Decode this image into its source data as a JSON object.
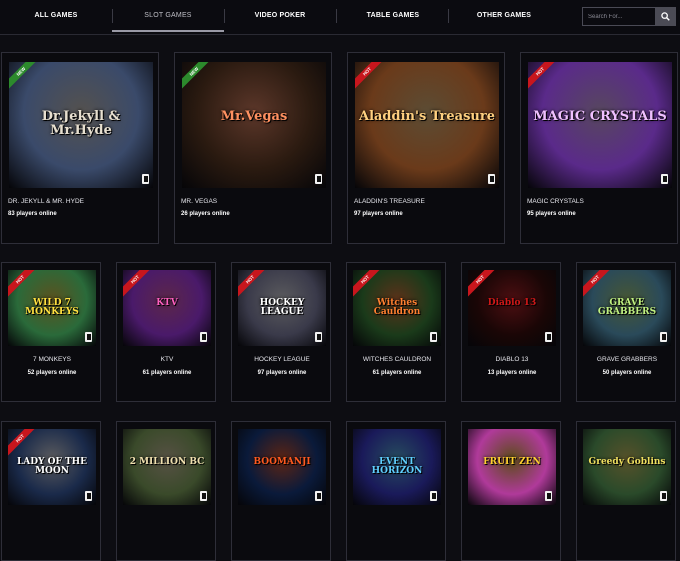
{
  "nav": {
    "tabs": [
      {
        "label": "ALL GAMES",
        "active": false
      },
      {
        "label": "SLOT GAMES",
        "active": true
      },
      {
        "label": "VIDEO POKER",
        "active": false
      },
      {
        "label": "TABLE GAMES",
        "active": false
      },
      {
        "label": "OTHER GAMES",
        "active": false
      }
    ],
    "search_placeholder": "Search For...",
    "search_icon": "search-icon"
  },
  "games": [
    {
      "name": "DR. JEKYLL & MR. HYDE",
      "players": "83 players online",
      "art_text": "Dr.Jekyll & Mr.Hyde",
      "badge": "NEW",
      "bg": "#3a4a6a",
      "accent": "#e8e0d0"
    },
    {
      "name": "MR. VEGAS",
      "players": "26 players online",
      "art_text": "Mr.Vegas",
      "badge": "NEW",
      "bg": "#2a1a10",
      "accent": "#ff9060"
    },
    {
      "name": "ALADDIN'S TREASURE",
      "players": "97 players online",
      "art_text": "Aladdin's Treasure",
      "badge": "HOT",
      "bg": "#6a3a1a",
      "accent": "#ffd080"
    },
    {
      "name": "MAGIC CRYSTALS",
      "players": "95 players online",
      "art_text": "MAGIC CRYSTALS",
      "badge": "HOT",
      "bg": "#5a2a8a",
      "accent": "#f0c0ff"
    },
    {
      "name": "7 MONKEYS",
      "players": "52 players online",
      "art_text": "WILD 7 MONKEYS",
      "badge": "HOT",
      "bg": "#2a6a3a",
      "accent": "#ffe040"
    },
    {
      "name": "KTV",
      "players": "61 players online",
      "art_text": "KTV",
      "badge": "HOT",
      "bg": "#4a1a6a",
      "accent": "#ff60c0"
    },
    {
      "name": "HOCKEY LEAGUE",
      "players": "97 players online",
      "art_text": "HOCKEY LEAGUE",
      "badge": "HOT",
      "bg": "#3a3a4a",
      "accent": "#ffffff"
    },
    {
      "name": "WITCHES CAULDRON",
      "players": "61 players online",
      "art_text": "Witches Cauldron",
      "badge": "HOT",
      "bg": "#1a3a1a",
      "accent": "#ff8030"
    },
    {
      "name": "DIABLO 13",
      "players": "13 players online",
      "art_text": "Diablo 13",
      "badge": "HOT",
      "bg": "#1a0606",
      "accent": "#d01818"
    },
    {
      "name": "GRAVE GRABBERS",
      "players": "50 players online",
      "art_text": "GRAVE GRABBERS",
      "badge": "HOT",
      "bg": "#2a4a5a",
      "accent": "#c0f080"
    },
    {
      "name": "",
      "players": "",
      "art_text": "LADY OF THE MOON",
      "badge": "HOT",
      "bg": "#1a2a4a",
      "accent": "#ffffff"
    },
    {
      "name": "",
      "players": "",
      "art_text": "2 MILLION BC",
      "badge": "",
      "bg": "#3a4a2a",
      "accent": "#f0e0b0"
    },
    {
      "name": "",
      "players": "",
      "art_text": "BOOMANJI",
      "badge": "",
      "bg": "#0a1a3a",
      "accent": "#ff5a20"
    },
    {
      "name": "",
      "players": "",
      "art_text": "EVENT HORIZON",
      "badge": "",
      "bg": "#1a1a5a",
      "accent": "#60d0ff"
    },
    {
      "name": "",
      "players": "",
      "art_text": "FRUIT ZEN",
      "badge": "",
      "bg": "#b03a9a",
      "accent": "#ffd030"
    },
    {
      "name": "",
      "players": "",
      "art_text": "Greedy Goblins",
      "badge": "",
      "bg": "#2a4a2a",
      "accent": "#f0e060"
    }
  ]
}
